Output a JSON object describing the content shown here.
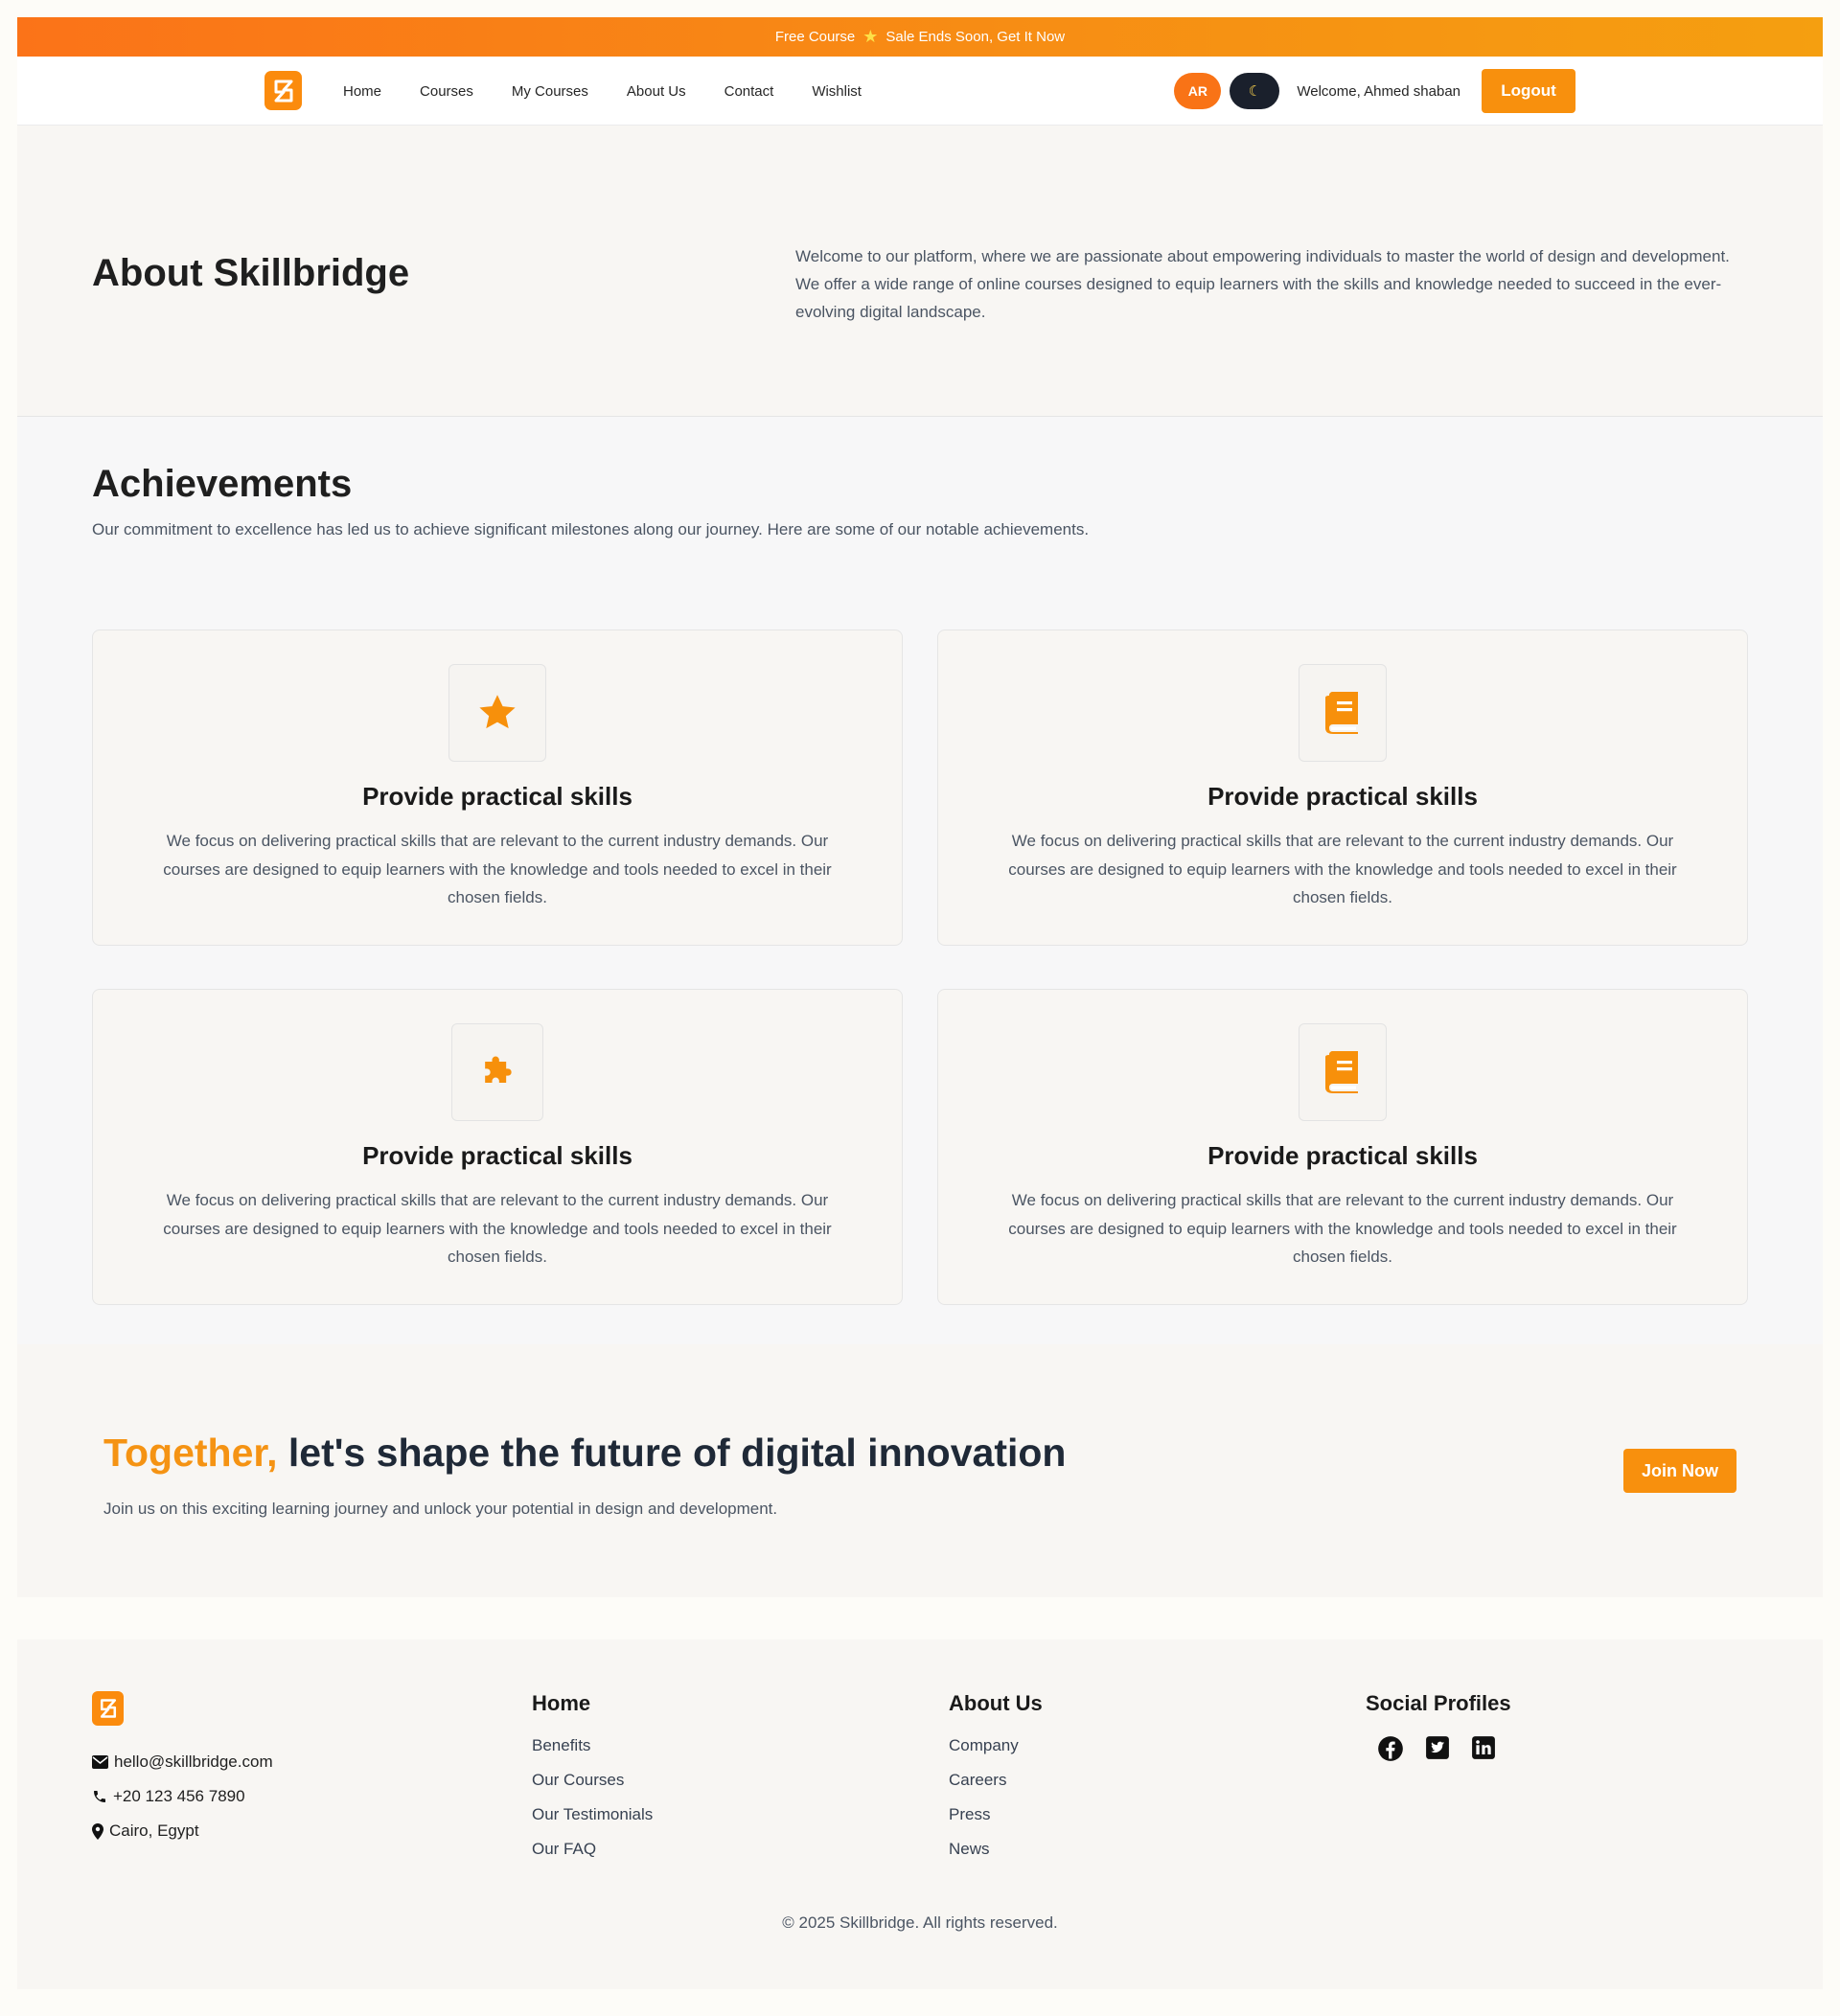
{
  "banner": {
    "left": "Free Course",
    "right": "Sale Ends Soon, Get It Now",
    "star_icon": "star-icon"
  },
  "nav": {
    "links": [
      "Home",
      "Courses",
      "My Courses",
      "About Us",
      "Contact",
      "Wishlist"
    ],
    "lang": "AR",
    "theme_icon": "moon-icon",
    "welcome": "Welcome, Ahmed shaban",
    "logout": "Logout"
  },
  "about": {
    "title": "About Skillbridge",
    "text": "Welcome to our platform, where we are passionate about empowering individuals to master the world of design and development. We offer a wide range of online courses designed to equip learners with the skills and knowledge needed to succeed in the ever-evolving digital landscape."
  },
  "achievements": {
    "title": "Achievements",
    "subtitle": "Our commitment to excellence has led us to achieve significant milestones along our journey. Here are some of our notable achievements.",
    "cards": [
      {
        "icon": "star-icon",
        "title": "Provide practical skills",
        "text": "We focus on delivering practical skills that are relevant to the current industry demands. Our courses are designed to equip learners with the knowledge and tools needed to excel in their chosen fields."
      },
      {
        "icon": "book-icon",
        "title": "Provide practical skills",
        "text": "We focus on delivering practical skills that are relevant to the current industry demands. Our courses are designed to equip learners with the knowledge and tools needed to excel in their chosen fields."
      },
      {
        "icon": "puzzle-icon",
        "title": "Provide practical skills",
        "text": "We focus on delivering practical skills that are relevant to the current industry demands. Our courses are designed to equip learners with the knowledge and tools needed to excel in their chosen fields."
      },
      {
        "icon": "book-icon",
        "title": "Provide practical skills",
        "text": "We focus on delivering practical skills that are relevant to the current industry demands. Our courses are designed to equip learners with the knowledge and tools needed to excel in their chosen fields."
      }
    ]
  },
  "cta": {
    "accent": "Together,",
    "title": " let's shape the future of digital innovation",
    "text": "Join us on this exciting learning journey and unlock your potential in design and development.",
    "button": "Join Now"
  },
  "footer": {
    "email": "hello@skillbridge.com",
    "phone": "+20 123 456 7890",
    "location": "Cairo, Egypt",
    "col_home": {
      "title": "Home",
      "links": [
        "Benefits",
        "Our Courses",
        "Our Testimonials",
        "Our FAQ"
      ]
    },
    "col_about": {
      "title": "About Us",
      "links": [
        "Company",
        "Careers",
        "Press",
        "News"
      ]
    },
    "col_social": {
      "title": "Social Profiles",
      "icons": [
        "facebook-icon",
        "twitter-icon",
        "linkedin-icon"
      ]
    },
    "copyright": "© 2025 Skillbridge. All rights reserved."
  },
  "colors": {
    "accent": "#f8900d",
    "banner_start": "#fb7318",
    "banner_end": "#f59f10",
    "dark": "#1a202c"
  }
}
